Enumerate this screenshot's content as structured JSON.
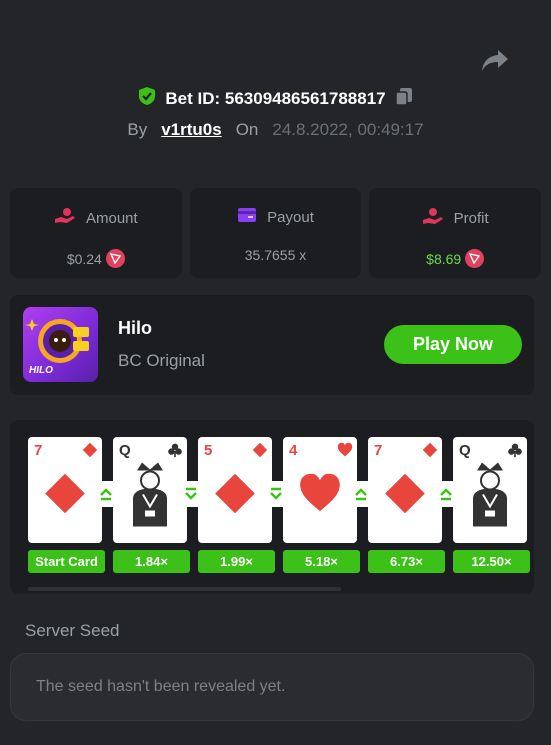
{
  "header": {
    "bet_id_label": "Bet ID: 56309486561788817",
    "by_label": "By",
    "username": "v1rtu0s",
    "on_label": "On",
    "date": "24.8.2022, 00:49:17"
  },
  "stats": {
    "amount": {
      "label": "Amount",
      "value": "$0.24",
      "icon": "money-hand-icon"
    },
    "payout": {
      "label": "Payout",
      "value": "35.7655 x",
      "icon": "wallet-icon"
    },
    "profit": {
      "label": "Profit",
      "value": "$8.69",
      "icon": "profit-hand-icon"
    }
  },
  "game": {
    "title": "Hilo",
    "subtitle": "BC Original",
    "thumb_label": "HILO",
    "play_label": "Play Now"
  },
  "cards": [
    {
      "rank": "7",
      "suit": "diamond",
      "color": "#e8453c",
      "mult": "Start Card"
    },
    {
      "rank": "Q",
      "suit": "club",
      "color": "#333333",
      "mult": "1.84×",
      "arrow": "up"
    },
    {
      "rank": "5",
      "suit": "diamond",
      "color": "#e8453c",
      "mult": "1.99×",
      "arrow": "down"
    },
    {
      "rank": "4",
      "suit": "heart",
      "color": "#e8453c",
      "mult": "5.18×",
      "arrow": "down"
    },
    {
      "rank": "7",
      "suit": "diamond",
      "color": "#e8453c",
      "mult": "6.73×",
      "arrow": "up"
    },
    {
      "rank": "Q",
      "suit": "club",
      "color": "#333333",
      "mult": "12.50×",
      "arrow": "up"
    }
  ],
  "seed": {
    "label": "Server Seed",
    "message": "The seed hasn't been revealed yet."
  },
  "colors": {
    "accent_green": "#3bc117",
    "profit_green": "#6fd84a",
    "trx_red": "#e2415e",
    "card_red": "#e8453c"
  }
}
